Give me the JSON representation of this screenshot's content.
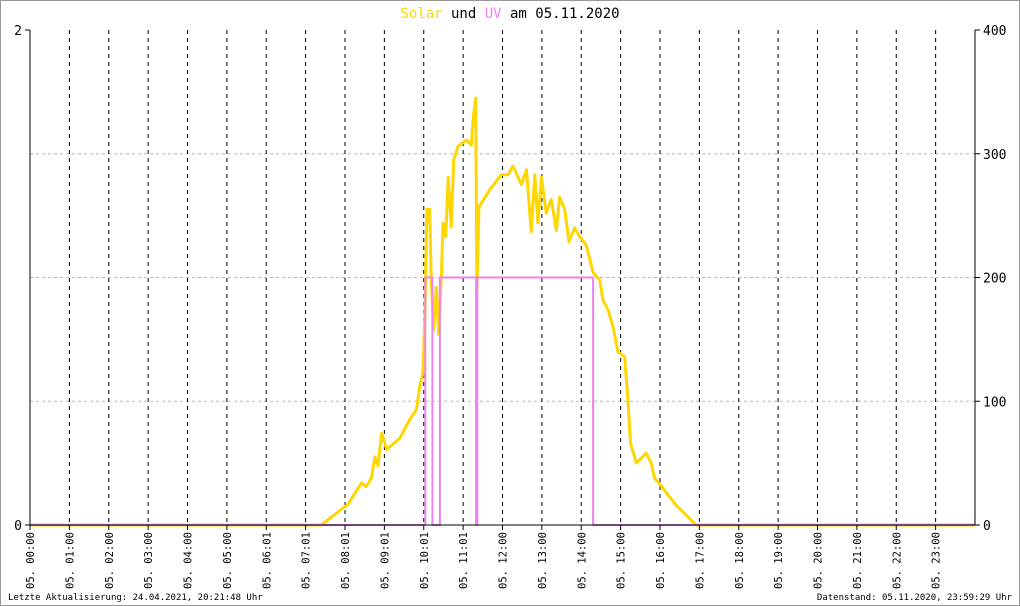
{
  "chart_data": {
    "type": "line",
    "title": {
      "part1": "Solar",
      "part2": " und ",
      "part3": "UV",
      "part4": " am 05.11.2020"
    },
    "x_range_hours": [
      0,
      24
    ],
    "left_axis": {
      "label": "UV",
      "ylim": [
        0,
        2
      ],
      "ticks": [
        "0",
        "2"
      ]
    },
    "right_axis": {
      "label": "Solar",
      "ylim": [
        0,
        400
      ],
      "ticks": [
        "0",
        "100",
        "200",
        "300",
        "400"
      ]
    },
    "x_tick_labels": [
      "05. 00:00",
      "05. 01:00",
      "05. 02:00",
      "05. 03:00",
      "05. 04:00",
      "05. 05:00",
      "05. 06:01",
      "05. 07:01",
      "05. 08:01",
      "05. 09:01",
      "05. 10:01",
      "05. 11:01",
      "05. 12:00",
      "05. 13:00",
      "05. 14:00",
      "05. 15:00",
      "05. 16:00",
      "05. 17:00",
      "05. 18:00",
      "05. 19:00",
      "05. 20:00",
      "05. 21:00",
      "05. 22:00",
      "05. 23:00"
    ],
    "grid": true,
    "series": [
      {
        "name": "Solar",
        "axis": "right",
        "color": "#FFD700",
        "points": [
          [
            0,
            0
          ],
          [
            7.4,
            0
          ],
          [
            8.08,
            17
          ],
          [
            8.42,
            34
          ],
          [
            8.54,
            31
          ],
          [
            8.67,
            38
          ],
          [
            8.76,
            55
          ],
          [
            8.84,
            48
          ],
          [
            8.93,
            74
          ],
          [
            9.06,
            61
          ],
          [
            9.39,
            70
          ],
          [
            9.64,
            85
          ],
          [
            9.81,
            93
          ],
          [
            9.9,
            112
          ],
          [
            9.98,
            123
          ],
          [
            10.03,
            171
          ],
          [
            10.08,
            255
          ],
          [
            10.15,
            255
          ],
          [
            10.19,
            200
          ],
          [
            10.25,
            158
          ],
          [
            10.32,
            192
          ],
          [
            10.38,
            154
          ],
          [
            10.45,
            204
          ],
          [
            10.49,
            244
          ],
          [
            10.56,
            233
          ],
          [
            10.62,
            281
          ],
          [
            10.7,
            241
          ],
          [
            10.76,
            295
          ],
          [
            10.87,
            306
          ],
          [
            11.08,
            311
          ],
          [
            11.21,
            307
          ],
          [
            11.25,
            327
          ],
          [
            11.32,
            345
          ],
          [
            11.35,
            187
          ],
          [
            11.4,
            257
          ],
          [
            11.68,
            271
          ],
          [
            11.97,
            283
          ],
          [
            12.14,
            283
          ],
          [
            12.27,
            290
          ],
          [
            12.48,
            275
          ],
          [
            12.61,
            287
          ],
          [
            12.73,
            237
          ],
          [
            12.82,
            283
          ],
          [
            12.9,
            244
          ],
          [
            12.99,
            281
          ],
          [
            13.11,
            252
          ],
          [
            13.24,
            263
          ],
          [
            13.37,
            238
          ],
          [
            13.45,
            265
          ],
          [
            13.58,
            255
          ],
          [
            13.69,
            229
          ],
          [
            13.83,
            240
          ],
          [
            13.96,
            233
          ],
          [
            14.13,
            226
          ],
          [
            14.3,
            204
          ],
          [
            14.47,
            198
          ],
          [
            14.55,
            182
          ],
          [
            14.68,
            174
          ],
          [
            14.81,
            160
          ],
          [
            14.93,
            140
          ],
          [
            15.1,
            136
          ],
          [
            15.18,
            104
          ],
          [
            15.25,
            66
          ],
          [
            15.4,
            50
          ],
          [
            15.65,
            58
          ],
          [
            15.78,
            50
          ],
          [
            15.86,
            38
          ],
          [
            16.07,
            30
          ],
          [
            16.41,
            16
          ],
          [
            16.92,
            0
          ],
          [
            24,
            0
          ]
        ]
      },
      {
        "name": "UV",
        "axis": "left",
        "color": "#EE82EE",
        "points": [
          [
            0,
            0
          ],
          [
            10.04,
            0
          ],
          [
            10.04,
            1
          ],
          [
            10.22,
            1
          ],
          [
            10.22,
            0
          ],
          [
            10.41,
            0
          ],
          [
            10.41,
            1
          ],
          [
            11.33,
            1
          ],
          [
            11.33,
            0
          ],
          [
            11.36,
            0
          ],
          [
            11.36,
            1
          ],
          [
            14.3,
            1
          ],
          [
            14.3,
            0
          ],
          [
            24,
            0
          ]
        ]
      }
    ]
  },
  "footer": {
    "last_update": "Letzte Aktualisierung: 24.04.2021, 20:21:48 Uhr",
    "data_state": "Datenstand: 05.11.2020, 23:59:29 Uhr"
  }
}
